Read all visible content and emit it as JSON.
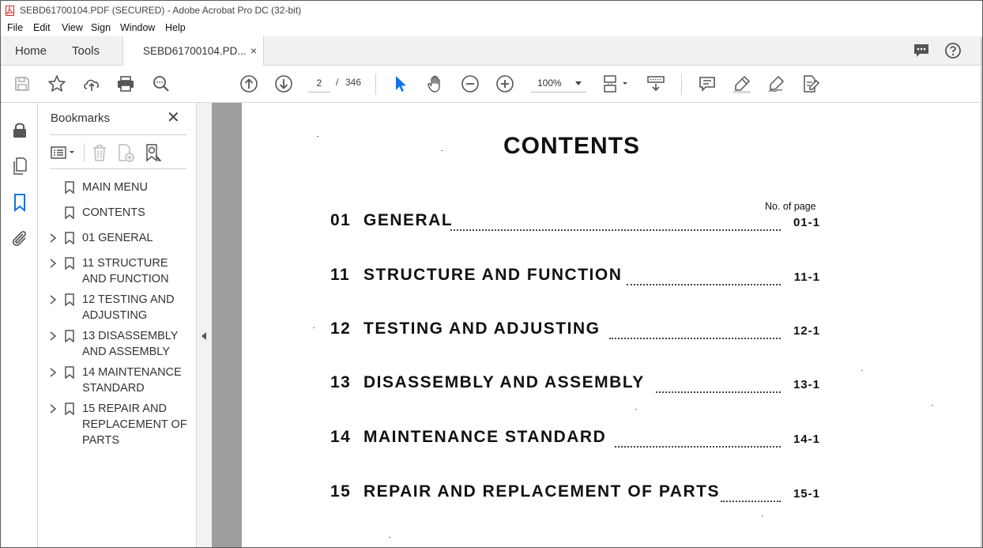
{
  "window": {
    "title": "SEBD61700104.PDF (SECURED) - Adobe Acrobat Pro DC (32-bit)"
  },
  "menu": [
    "File",
    "Edit",
    "View",
    "Sign",
    "Window",
    "Help"
  ],
  "tabs": {
    "home": "Home",
    "tools": "Tools",
    "document": "SEBD61700104.PD...",
    "close": "×"
  },
  "toolbar": {
    "current_page": "2",
    "page_separator": "/",
    "total_pages": "346",
    "zoom": "100%"
  },
  "bookmarks_panel": {
    "title": "Bookmarks",
    "close": "✕",
    "items": [
      {
        "label": "MAIN MENU",
        "expandable": false
      },
      {
        "label": "CONTENTS",
        "expandable": false
      },
      {
        "label": "01 GENERAL",
        "expandable": true
      },
      {
        "label": "11 STRUCTURE AND FUNCTION",
        "expandable": true
      },
      {
        "label": "12 TESTING AND ADJUSTING",
        "expandable": true
      },
      {
        "label": "13 DISASSEMBLY AND ASSEMBLY",
        "expandable": true
      },
      {
        "label": "14 MAINTENANCE STANDARD",
        "expandable": true
      },
      {
        "label": "15 REPAIR AND REPLACEMENT OF PARTS",
        "expandable": true
      }
    ]
  },
  "document": {
    "heading": "CONTENTS",
    "page_column_header": "No. of page",
    "toc": [
      {
        "num": "01",
        "title": "GENERAL",
        "page": "01-1"
      },
      {
        "num": "11",
        "title": "STRUCTURE  AND  FUNCTION",
        "page": "11-1"
      },
      {
        "num": "12",
        "title": "TESTING  AND  ADJUSTING",
        "page": "12-1"
      },
      {
        "num": "13",
        "title": "DISASSEMBLY  AND  ASSEMBLY",
        "page": "13-1"
      },
      {
        "num": "14",
        "title": "MAINTENANCE  STANDARD",
        "page": "14-1"
      },
      {
        "num": "15",
        "title": "REPAIR  AND  REPLACEMENT  OF  PARTS",
        "page": "15-1"
      }
    ]
  },
  "colors": {
    "accent_blue": "#1473e6",
    "pdf_red": "#d9251c",
    "gutter_gray": "#9e9e9e"
  }
}
